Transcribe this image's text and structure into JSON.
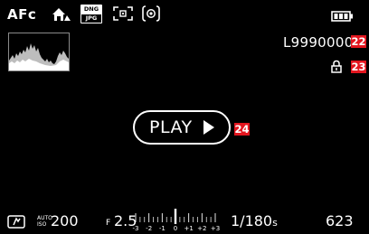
{
  "top_bar": {
    "focus_mode": "AFc",
    "file_format_top": "DNG",
    "file_format_bottom": "JPG",
    "icons": [
      "scene-mode-icon",
      "af-field-icon",
      "spot-metering-icon",
      "battery-icon"
    ]
  },
  "right_info": {
    "file_number": "L9990000"
  },
  "callouts": {
    "c22": "22",
    "c23": "23",
    "c24": "24"
  },
  "center": {
    "play_label": "PLAY"
  },
  "bottom_bar": {
    "iso_label_top": "AUTO",
    "iso_label_bottom": "ISO",
    "iso_value": "200",
    "aperture_prefix": "F",
    "aperture_value": "2.5",
    "ev_scale_labels": [
      "-3",
      "-2",
      "-1",
      "0",
      "+1",
      "+2",
      "+3"
    ],
    "ev_value": 0,
    "shutter_value": "1/180",
    "shutter_unit": "s",
    "remaining_shots": "623"
  },
  "colors": {
    "background": "#000000",
    "foreground": "#ffffff",
    "callout": "#e3161f",
    "histogram_border": "#8a8a8a"
  }
}
